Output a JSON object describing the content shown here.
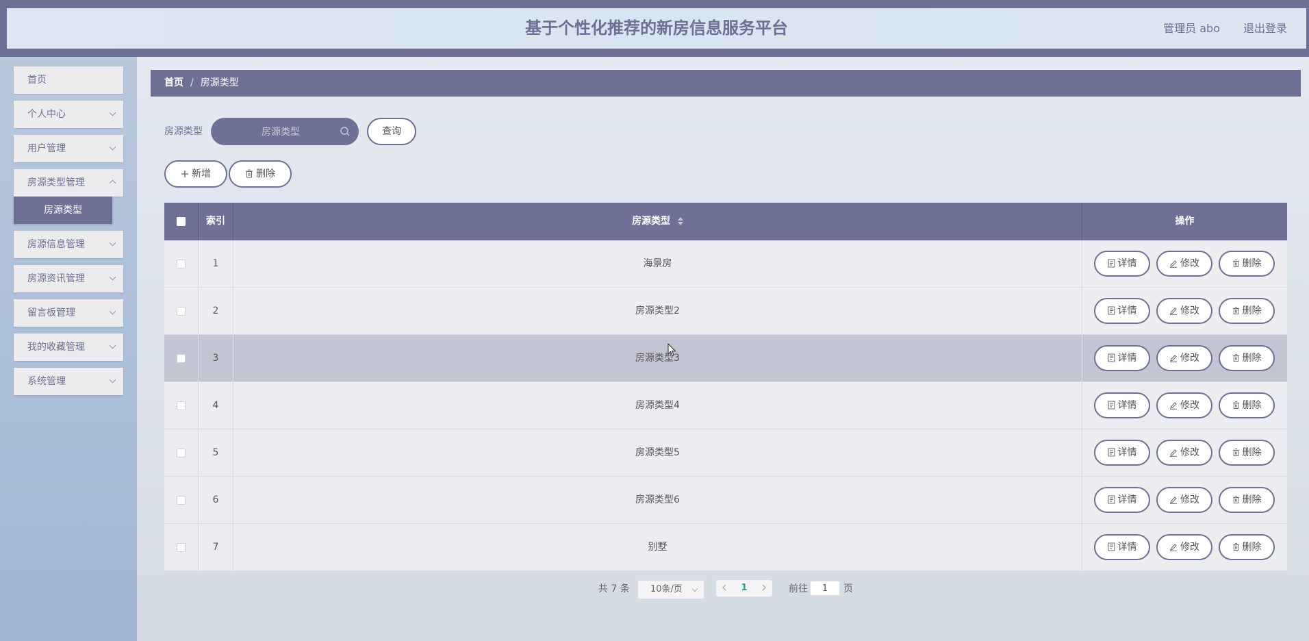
{
  "header": {
    "title": "基于个性化推荐的新房信息服务平台",
    "user_label": "管理员 abo",
    "logout": "退出登录"
  },
  "sidebar": {
    "items": [
      {
        "label": "首页"
      },
      {
        "label": "个人中心"
      },
      {
        "label": "用户管理"
      },
      {
        "label": "房源类型管理"
      },
      {
        "label": "房源信息管理"
      },
      {
        "label": "房源资讯管理"
      },
      {
        "label": "留言板管理"
      },
      {
        "label": "我的收藏管理"
      },
      {
        "label": "系统管理"
      }
    ],
    "active_sub": "房源类型"
  },
  "breadcrumb": {
    "home": "首页",
    "separator": "/",
    "current": "房源类型"
  },
  "search": {
    "label": "房源类型",
    "placeholder": "房源类型",
    "value": "",
    "query_button": "查询"
  },
  "toolbar": {
    "add_button": "新增",
    "delete_button": "删除"
  },
  "table": {
    "columns": [
      "",
      "索引",
      "房源类型",
      "操作"
    ],
    "rows": [
      {
        "index": "1",
        "type": "海景房"
      },
      {
        "index": "2",
        "type": "房源类型2"
      },
      {
        "index": "3",
        "type": "房源类型3"
      },
      {
        "index": "4",
        "type": "房源类型4"
      },
      {
        "index": "5",
        "type": "房源类型5"
      },
      {
        "index": "6",
        "type": "房源类型6"
      },
      {
        "index": "7",
        "type": "别墅"
      }
    ],
    "actions": {
      "detail": "详情",
      "edit": "修改",
      "delete": "删除"
    }
  },
  "pagination": {
    "total": "共 7 条",
    "page_size": "10条/页",
    "current_page": "1",
    "goto_label": "前往",
    "goto_value": "1",
    "page_suffix": "页"
  },
  "colors": {
    "primary": "#6f7095",
    "header_bg": "#dce6f0",
    "sidebar_bg": "#a9bed8",
    "page_current": "#26a08a"
  }
}
